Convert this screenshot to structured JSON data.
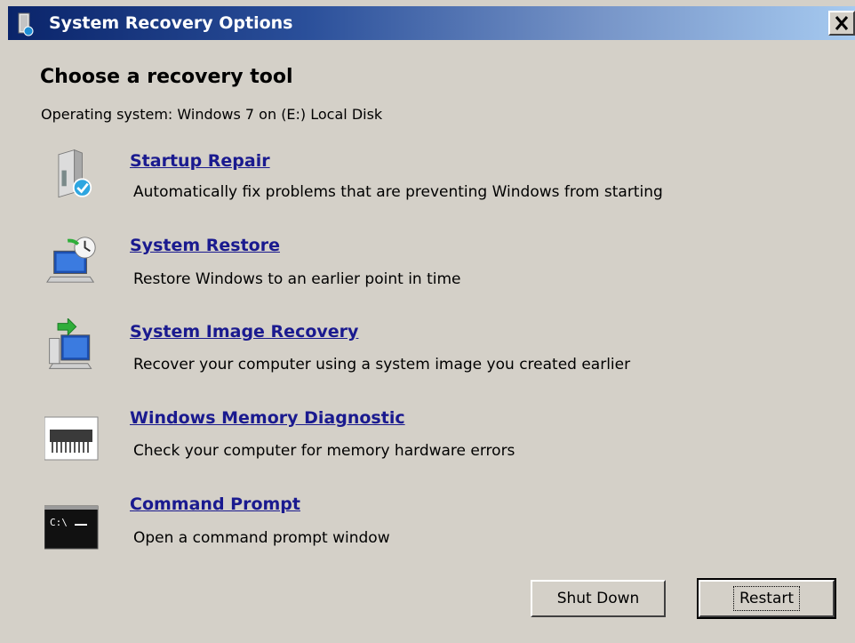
{
  "window": {
    "title": "System Recovery Options",
    "close_glyph": "X"
  },
  "heading": "Choose a recovery tool",
  "os_line": "Operating system: Windows 7 on (E:) Local Disk",
  "tools": [
    {
      "label": "Startup Repair",
      "description": "Automatically fix problems that are preventing Windows from starting",
      "icon": "startup-repair-icon"
    },
    {
      "label": "System Restore",
      "description": "Restore Windows to an earlier point in time",
      "icon": "system-restore-icon"
    },
    {
      "label": "System Image Recovery",
      "description": "Recover your computer using a system image you created earlier",
      "icon": "system-image-recovery-icon"
    },
    {
      "label": "Windows Memory Diagnostic",
      "description": "Check your computer for memory hardware errors",
      "icon": "memory-diagnostic-icon"
    },
    {
      "label": "Command Prompt",
      "description": "Open a command prompt window",
      "icon": "command-prompt-icon"
    }
  ],
  "buttons": {
    "shutdown_label": "Shut Down",
    "restart_label": "Restart"
  },
  "colors": {
    "link": "#1a1a8f",
    "title_bar_start": "#0a246a",
    "title_bar_end": "#a6caf0",
    "window_bg": "#d4d0c8"
  }
}
